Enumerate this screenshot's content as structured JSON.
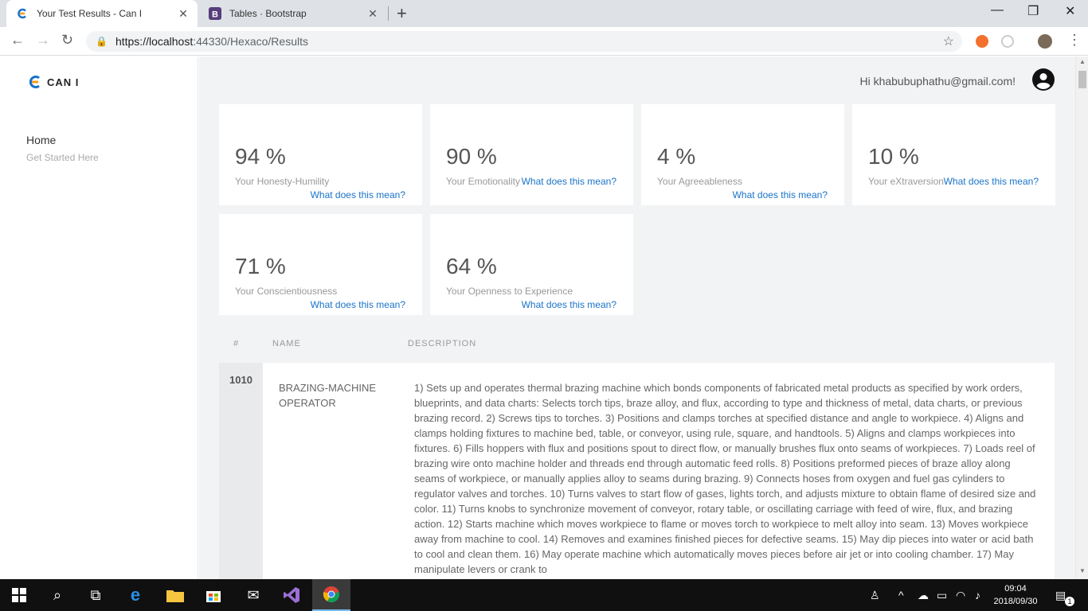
{
  "browser": {
    "tabs": [
      {
        "title": "Your Test Results - Can I",
        "active": true
      },
      {
        "title": "Tables · Bootstrap",
        "active": false
      }
    ],
    "url_host": "https://localhost",
    "url_rest": ":44330/Hexaco/Results"
  },
  "sidebar": {
    "logo_text": "CAN I",
    "home_label": "Home",
    "home_sub": "Get Started Here"
  },
  "header": {
    "greeting": "Hi khabubuphathu@gmail.com!"
  },
  "cards": [
    {
      "percent": "94 %",
      "label": "Your Honesty-Humility",
      "link": "What does this mean?"
    },
    {
      "percent": "90 %",
      "label": "Your Emotionality",
      "link": "What does this mean?"
    },
    {
      "percent": "4 %",
      "label": "Your Agreeableness",
      "link": "What does this mean?"
    },
    {
      "percent": "10 %",
      "label": "Your eXtraversion",
      "link": "What does this mean?"
    },
    {
      "percent": "71 %",
      "label": "Your Conscientiousness",
      "link": "What does this mean?"
    },
    {
      "percent": "64 %",
      "label": "Your Openness to Experience",
      "link": "What does this mean?"
    }
  ],
  "table": {
    "headers": [
      "#",
      "NAME",
      "DESCRIPTION"
    ],
    "rows": [
      {
        "id": "1010",
        "name": "BRAZING-MACHINE OPERATOR",
        "description": "1) Sets up and operates thermal brazing machine which bonds components of fabricated metal products as specified by work orders, blueprints, and data charts: Selects torch tips, braze alloy, and flux, according to type and thickness of metal, data charts, or previous brazing record. 2) Screws tips to torches. 3) Positions and clamps torches at specified distance and angle to workpiece. 4) Aligns and clamps holding fixtures to machine bed, table, or conveyor, using rule, square, and handtools. 5) Aligns and clamps workpieces into fixtures. 6) Fills hoppers with flux and positions spout to direct flow, or manually brushes flux onto seams of workpieces. 7) Loads reel of brazing wire onto machine holder and threads end through automatic feed rolls. 8) Positions preformed pieces of braze alloy along seams of workpiece, or manually applies alloy to seams during brazing. 9) Connects hoses from oxygen and fuel gas cylinders to regulator valves and torches. 10) Turns valves to start flow of gases, lights torch, and adjusts mixture to obtain flame of desired size and color. 11) Turns knobs to synchronize movement of conveyor, rotary table, or oscillating carriage with feed of wire, flux, and brazing action. 12) Starts machine which moves workpiece to flame or moves torch to workpiece to melt alloy into seam. 13) Moves workpiece away from machine to cool. 14) Removes and examines finished pieces for defective seams. 15) May dip pieces into water or acid bath to cool and clean them. 16) May operate machine which automatically moves pieces before air jet or into cooling chamber. 17) May manipulate levers or crank to"
      }
    ]
  },
  "taskbar": {
    "time": "09:04",
    "date": "2018/09/30",
    "notification_count": "1"
  },
  "colors": {
    "link": "#1a73c8",
    "main_bg": "#f2f3f5",
    "logo_blue": "#1a73c8",
    "logo_orange": "#f29b1d"
  }
}
